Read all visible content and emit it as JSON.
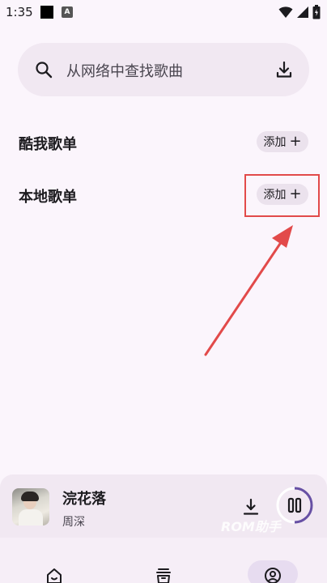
{
  "status_bar": {
    "time": "1:35",
    "notification_a": "A"
  },
  "search": {
    "placeholder": "从网络中查找歌曲"
  },
  "sections": {
    "kuwo_playlist": {
      "title": "酷我歌单",
      "add_label": "添加"
    },
    "local_playlist": {
      "title": "本地歌单",
      "add_label": "添加"
    }
  },
  "player": {
    "song_title": "浣花落",
    "artist": "周深",
    "watermark": "ROM助手"
  },
  "icons": {
    "search": "search-icon",
    "download": "download-icon",
    "plus": "plus-icon",
    "pause": "pause-icon",
    "home": "home-icon",
    "library": "library-icon",
    "profile": "profile-icon"
  },
  "colors": {
    "background": "#fbf5fc",
    "search_bg": "#f1e8f2",
    "add_button_bg": "#ebe2ed",
    "highlight": "#e24a4a",
    "accent_purple": "#6750a4",
    "nav_active": "#e7dcf0"
  }
}
